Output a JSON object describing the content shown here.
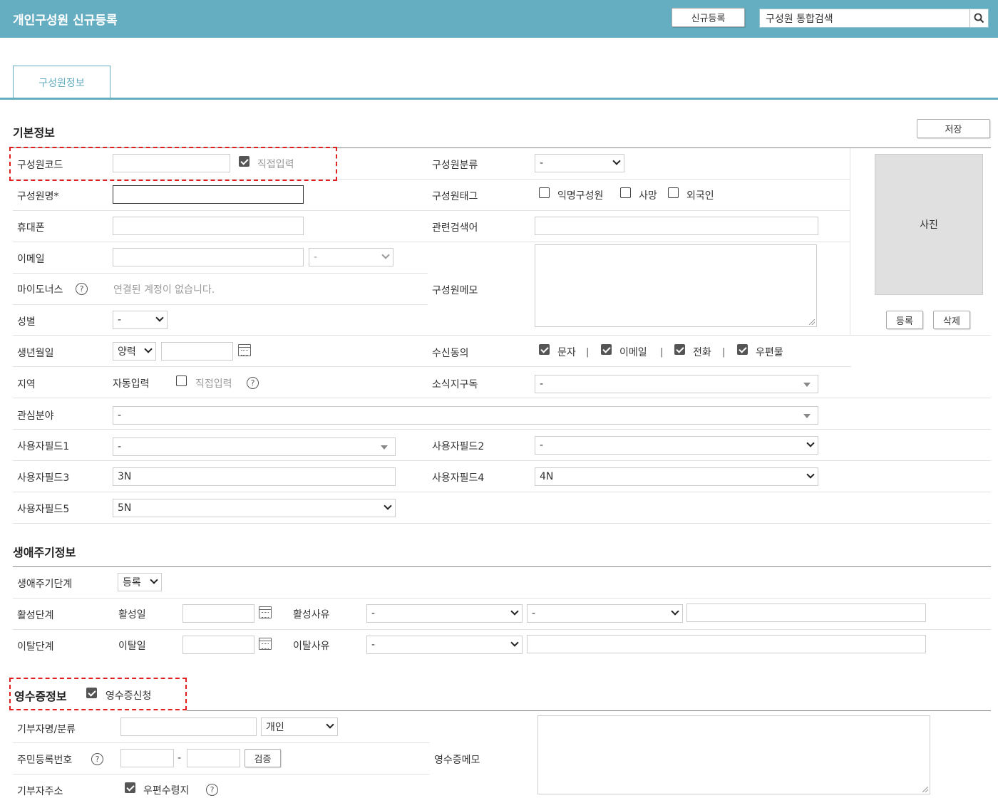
{
  "header": {
    "title": "개인구성원 신규등록",
    "new_button": "신규등록",
    "search_value": "구성원 통합검색"
  },
  "tabs": [
    {
      "label": "구성원정보"
    }
  ],
  "basic": {
    "title": "기본정보",
    "save_button": "저장",
    "code_label": "구성원코드",
    "code_direct_label": "직접입력",
    "name_label": "구성원명*",
    "phone_label": "휴대폰",
    "email_label": "이메일",
    "email_domain": "-",
    "mydonors_label": "마이도너스",
    "mydonors_value": "연결된 계정이 없습니다.",
    "gender_label": "성별",
    "gender_value": "-",
    "birth_label": "생년월일",
    "birth_calendar": "양력",
    "region_label": "지역",
    "region_auto": "자동입력",
    "region_direct": "직접입력",
    "interest_label": "관심분야",
    "interest_value": "-",
    "uf1_label": "사용자필드1",
    "uf1_value": "-",
    "uf3_label": "사용자필드3",
    "uf3_value": "3N",
    "uf5_label": "사용자필드5",
    "uf5_value": "5N",
    "category_label": "구성원분류",
    "category_value": "-",
    "tag_label": "구성원태그",
    "tag_anonymous": "익명구성원",
    "tag_deceased": "사망",
    "tag_foreigner": "외국인",
    "keyword_label": "관련검색어",
    "memo_label": "구성원메모",
    "consent_label": "수신동의",
    "consent_sms": "문자",
    "consent_email": "이메일",
    "consent_phone": "전화",
    "consent_mail": "우편물",
    "consent_sep": "|",
    "news_label": "소식지구독",
    "news_value": "-",
    "uf2_label": "사용자필드2",
    "uf2_value": "-",
    "uf4_label": "사용자필드4",
    "uf4_value": "4N",
    "photo_label": "사진",
    "photo_register": "등록",
    "photo_delete": "삭제",
    "help_glyph": "?"
  },
  "lifecycle": {
    "title": "생애주기정보",
    "stage_label": "생애주기단계",
    "stage_value": "등록",
    "active_label": "활성단계",
    "active_date_label": "활성일",
    "active_reason_label": "활성사유",
    "active_reason1": "-",
    "active_reason2": "-",
    "churn_label": "이탈단계",
    "churn_date_label": "이탈일",
    "churn_reason_label": "이탈사유",
    "churn_reason": "-"
  },
  "receipt": {
    "title": "영수증정보",
    "apply_label": "영수증신청",
    "donor_label": "기부자명/분류",
    "donor_type": "개인",
    "rrn_label": "주민등록번호",
    "rrn_dash": "-",
    "verify_button": "검증",
    "address_label": "기부자주소",
    "postal_label": "우편수령지",
    "memo_label": "영수증메모"
  }
}
